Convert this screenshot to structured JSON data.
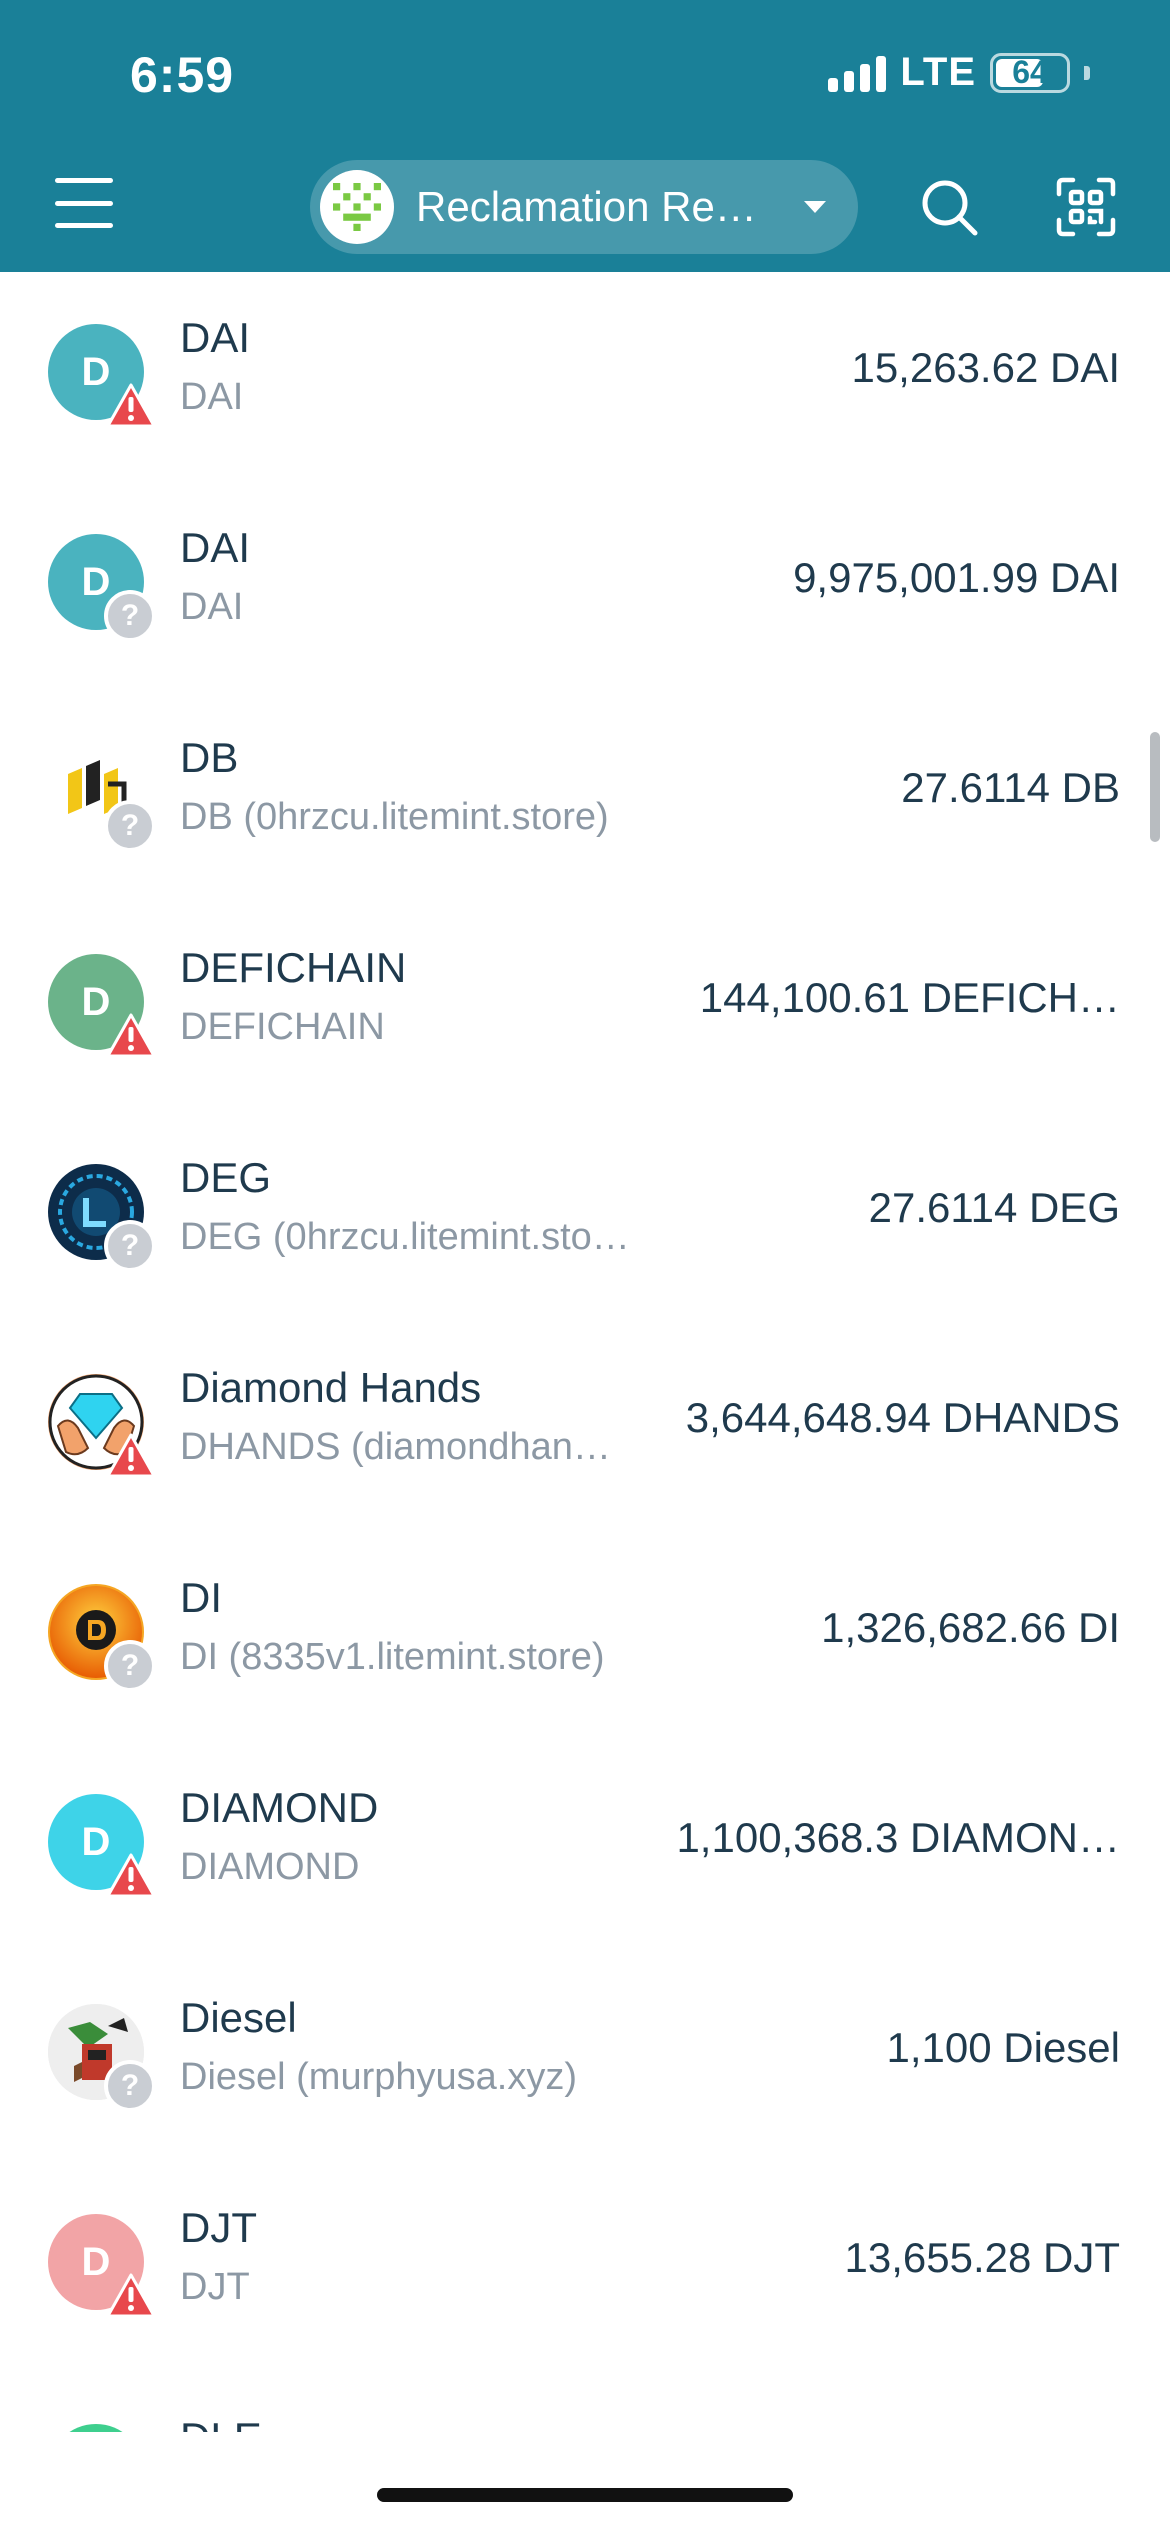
{
  "status_bar": {
    "time": "6:59",
    "network": "LTE",
    "battery": "64"
  },
  "header": {
    "account_name": "Reclamation Re…",
    "icons": {
      "menu": "hamburger-menu-icon",
      "search": "search-icon",
      "scan": "qr-scan-icon",
      "account": "account-avatar-icon"
    }
  },
  "colors": {
    "header_bg": "#1a8098",
    "warn": "#e8484c",
    "unknown": "#c9cdd3",
    "text_primary": "#1f3a4d",
    "text_secondary": "#8c98a4"
  },
  "tokens": [
    {
      "letter": "D",
      "name": "DAI",
      "subtitle": "DAI",
      "balance": "15,263.62 DAI",
      "color": "#4ab3bf",
      "badge": "warning"
    },
    {
      "letter": "D",
      "name": "DAI",
      "subtitle": "DAI",
      "balance": "9,975,001.99 DAI",
      "color": "#4ab3bf",
      "badge": "unknown"
    },
    {
      "letter": "",
      "name": "DB",
      "subtitle": "DB (0hrzcu.litemint.store)",
      "balance": "27.6114 DB",
      "color": "#ffffff",
      "badge": "unknown",
      "logo": "db-logo"
    },
    {
      "letter": "D",
      "name": "DEFICHAIN",
      "subtitle": "DEFICHAIN",
      "balance": "144,100.61 DEFICH…",
      "color": "#6bb38a",
      "badge": "warning"
    },
    {
      "letter": "",
      "name": "DEG",
      "subtitle": "DEG (0hrzcu.litemint.store)",
      "balance": "27.6114 DEG",
      "color": "#0d2c4a",
      "badge": "unknown",
      "logo": "deg-logo"
    },
    {
      "letter": "",
      "name": "Diamond Hands",
      "subtitle": "DHANDS (diamondhan…",
      "balance": "3,644,648.94 DHANDS",
      "color": "#f2a26b",
      "badge": "warning",
      "logo": "diamond-hands-logo"
    },
    {
      "letter": "",
      "name": "DI",
      "subtitle": "DI (8335v1.litemint.store)",
      "balance": "1,326,682.66 DI",
      "color": "#f5a623",
      "badge": "unknown",
      "logo": "di-logo"
    },
    {
      "letter": "D",
      "name": "DIAMOND",
      "subtitle": "DIAMOND",
      "balance": "1,100,368.3 DIAMON…",
      "color": "#3ed3e8",
      "badge": "warning"
    },
    {
      "letter": "",
      "name": "Diesel",
      "subtitle": "Diesel (murphyusa.xyz)",
      "balance": "1,100 Diesel",
      "color": "#eeeeee",
      "badge": "unknown",
      "logo": "diesel-logo"
    },
    {
      "letter": "D",
      "name": "DJT",
      "subtitle": "DJT",
      "balance": "13,655.28 DJT",
      "color": "#f2a4a6",
      "badge": "warning"
    },
    {
      "letter": "",
      "name": "DLE",
      "subtitle": "",
      "balance": "",
      "color": "#3ecf8e",
      "badge": "none"
    }
  ]
}
